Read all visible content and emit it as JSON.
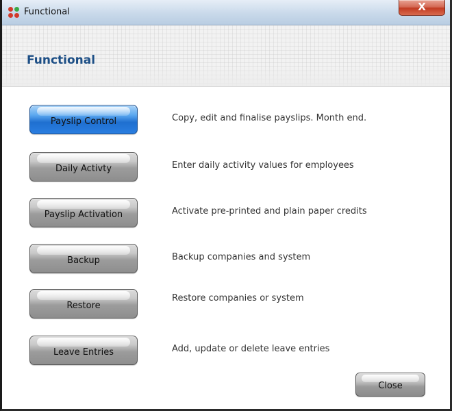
{
  "window": {
    "title": "Functional",
    "close_glyph": "X"
  },
  "header": {
    "title": "Functional"
  },
  "rows": [
    {
      "button": "Payslip Control",
      "description": "Copy, edit and finalise payslips. Month end."
    },
    {
      "button": "Daily Activty",
      "description": "Enter daily activity values for employees"
    },
    {
      "button": "Payslip Activation",
      "description": "Activate pre-printed and plain paper credits"
    },
    {
      "button": "Backup",
      "description": "Backup companies and system"
    },
    {
      "button": "Restore",
      "description": "Restore companies or system"
    },
    {
      "button": "Leave Entries",
      "description": "Add, update or delete leave entries"
    }
  ],
  "footer": {
    "close_label": "Close"
  },
  "icons": {
    "app": "app-grid-icon",
    "close": "close-icon"
  },
  "colors": {
    "title_blue": "#1d4f86",
    "primary_button": "#2a7ee0",
    "icon_red": "#d23a2a",
    "icon_green": "#3aa845"
  }
}
